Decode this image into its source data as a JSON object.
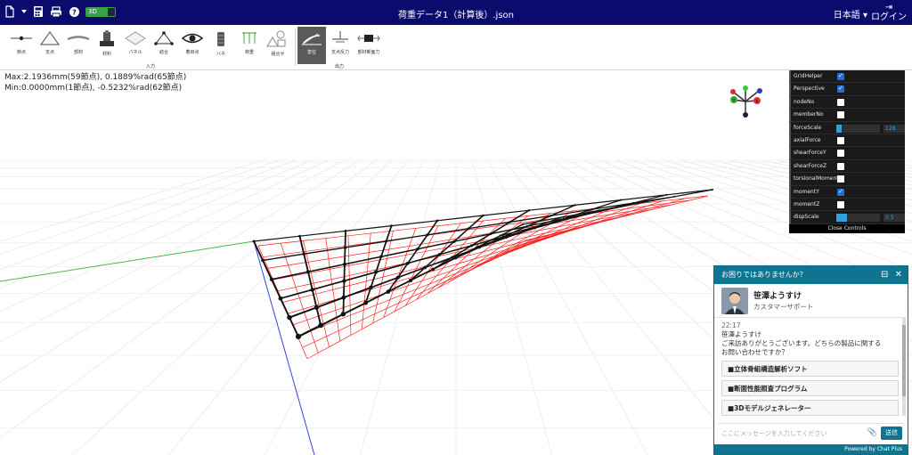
{
  "header": {
    "title": "荷重データ1（計算後）.json",
    "toggle_label": "3D",
    "language": "日本語",
    "login": "ログイン"
  },
  "toolbar": {
    "input_items": [
      "節点",
      "支点",
      "部材",
      "材料",
      "パネル",
      "結合",
      "着目点",
      "バネ",
      "荷重",
      "組合せ"
    ],
    "input_group": "入力",
    "output_items": [
      "変位",
      "支点反力",
      "部材断面力"
    ],
    "output_group": "出力"
  },
  "info": {
    "max": "Max:2.1936mm(59節点), 0.1889%rad(65節点)",
    "min": "Min:0.0000mm(1節点), -0.5232%rad(62節点)"
  },
  "controls": {
    "rows": [
      {
        "label": "GridHelper",
        "type": "checkbox",
        "checked": true
      },
      {
        "label": "Perspective",
        "type": "checkbox",
        "checked": true
      },
      {
        "label": "nodeNo",
        "type": "checkbox",
        "checked": false
      },
      {
        "label": "memberNo",
        "type": "checkbox",
        "checked": false
      },
      {
        "label": "forceScale",
        "type": "slider",
        "value": "128",
        "fill": 0.12
      },
      {
        "label": "axialForce",
        "type": "checkbox",
        "checked": false
      },
      {
        "label": "shearForceY",
        "type": "checkbox",
        "checked": false
      },
      {
        "label": "shearForceZ",
        "type": "checkbox",
        "checked": false
      },
      {
        "label": "torsionalMoment",
        "type": "checkbox",
        "checked": false
      },
      {
        "label": "momentY",
        "type": "checkbox",
        "checked": true
      },
      {
        "label": "momentZ",
        "type": "checkbox",
        "checked": false
      },
      {
        "label": "dispScale",
        "type": "slider",
        "value": "0.5",
        "fill": 0.25
      }
    ],
    "close_label": "Close Controls"
  },
  "gizmo": {
    "labels": [
      "Y",
      "X"
    ]
  },
  "chat": {
    "header": "お困りではありませんか？",
    "agent_name": "笹澤ようすけ",
    "agent_role": "カスタマーサポート",
    "time": "22:17",
    "sender": "笹澤ようすけ",
    "message": "ご来訪ありがとうございます。どちらの製品に関するお問い合わせですか？",
    "options": [
      "■立体骨組構造解析ソフト",
      "■断面性能照査プログラム",
      "■3Dモデルジェネレーター"
    ],
    "input_placeholder": "ここにメッセージを入力してください",
    "send_label": "送信",
    "footer": "Powered by Chat Plus"
  },
  "colors": {
    "header_bg": "#0b0b6e",
    "chat_accent": "#0e7490",
    "grid_red": "#ff0000",
    "slider_blue": "#2fa1d6"
  }
}
